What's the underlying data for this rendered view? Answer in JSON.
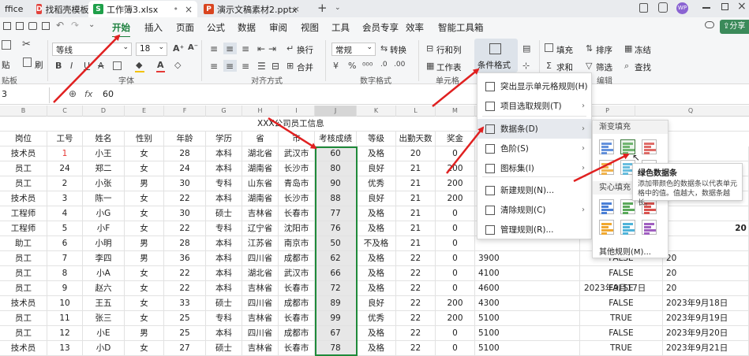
{
  "tabs": [
    {
      "label": "ffice"
    },
    {
      "label": "找稻壳模板",
      "icon": "D"
    },
    {
      "label": "工作簿3.xlsx",
      "icon": "S"
    },
    {
      "label": "演示文稿素材2.pptx",
      "icon": "P"
    }
  ],
  "new_tab_label": "+",
  "avatar_label": "WP",
  "share_label": "分享",
  "menus": [
    "开始",
    "插入",
    "页面",
    "公式",
    "数据",
    "审阅",
    "视图",
    "工具",
    "会员专享",
    "效率",
    "智能工具箱"
  ],
  "active_menu": "开始",
  "ribbon": {
    "font_name": "等线",
    "font_size": "18",
    "number_format": "常规",
    "wrap": "换行",
    "merge": "合并",
    "convert": "转换",
    "rowcol": "行和列",
    "worksheet": "工作表",
    "cond_format": "条件格式",
    "fill": "填充",
    "sort": "排序",
    "freeze": "冻结",
    "sum": "求和",
    "filter": "筛选",
    "find": "查找",
    "paste": "贴",
    "brush": "刷",
    "groups": [
      "贴板",
      "字体",
      "对齐方式",
      "数字格式",
      "单元格",
      "编辑"
    ]
  },
  "formula_bar": {
    "cell_ref": "3",
    "fx": "fx",
    "value": "60"
  },
  "columns": [
    "B",
    "C",
    "D",
    "E",
    "F",
    "G",
    "H",
    "I",
    "J",
    "K",
    "L",
    "M",
    "P",
    "Q"
  ],
  "sheet_title": "XXX公司员工信息",
  "headers": [
    "岗位",
    "工号",
    "姓名",
    "性别",
    "年龄",
    "学历",
    "省",
    "市",
    "考核成绩",
    "等级",
    "出勤天数",
    "奖金"
  ],
  "rows": [
    [
      "技术员",
      "1",
      "小王",
      "女",
      "28",
      "本科",
      "湖北省",
      "武汉市",
      "60",
      "及格",
      "20",
      "0",
      "",
      "",
      ""
    ],
    [
      "员工",
      "24",
      "郑二",
      "女",
      "24",
      "本科",
      "湖南省",
      "长沙市",
      "80",
      "良好",
      "21",
      "200",
      "",
      "",
      ""
    ],
    [
      "员工",
      "2",
      "小张",
      "男",
      "30",
      "专科",
      "山东省",
      "青岛市",
      "90",
      "优秀",
      "21",
      "200",
      "",
      "",
      ""
    ],
    [
      "技术员",
      "3",
      "陈一",
      "女",
      "22",
      "本科",
      "湖南省",
      "长沙市",
      "88",
      "良好",
      "21",
      "200",
      "",
      "",
      ""
    ],
    [
      "工程师",
      "4",
      "小G",
      "女",
      "30",
      "硕士",
      "吉林省",
      "长春市",
      "77",
      "及格",
      "21",
      "0",
      "",
      "",
      ""
    ],
    [
      "工程师",
      "5",
      "小F",
      "女",
      "22",
      "专科",
      "辽宁省",
      "沈阳市",
      "76",
      "及格",
      "21",
      "0",
      "",
      "",
      ""
    ],
    [
      "助工",
      "6",
      "小明",
      "男",
      "28",
      "本科",
      "江苏省",
      "南京市",
      "50",
      "不及格",
      "21",
      "0",
      "",
      "",
      ""
    ],
    [
      "员工",
      "7",
      "李四",
      "男",
      "36",
      "本科",
      "四川省",
      "成都市",
      "62",
      "及格",
      "22",
      "0",
      "3900",
      "FALSE",
      "20"
    ],
    [
      "员工",
      "8",
      "小A",
      "女",
      "22",
      "本科",
      "湖北省",
      "武汉市",
      "66",
      "及格",
      "22",
      "0",
      "4100",
      "FALSE",
      "20"
    ],
    [
      "员工",
      "9",
      "赵六",
      "女",
      "22",
      "本科",
      "吉林省",
      "长春市",
      "72",
      "及格",
      "22",
      "0",
      "4600",
      "FALSE",
      "20"
    ],
    [
      "技术员",
      "10",
      "王五",
      "女",
      "33",
      "硕士",
      "四川省",
      "成都市",
      "89",
      "良好",
      "22",
      "200",
      "4300",
      "FALSE",
      "2023年9月18日"
    ],
    [
      "员工",
      "11",
      "张三",
      "女",
      "25",
      "专科",
      "吉林省",
      "长春市",
      "99",
      "优秀",
      "22",
      "200",
      "5100",
      "TRUE",
      "2023年9月19日"
    ],
    [
      "员工",
      "12",
      "小E",
      "男",
      "25",
      "本科",
      "四川省",
      "成都市",
      "67",
      "及格",
      "22",
      "0",
      "5100",
      "FALSE",
      "2023年9月20日"
    ],
    [
      "技术员",
      "13",
      "小D",
      "女",
      "27",
      "硕士",
      "吉林省",
      "长春市",
      "78",
      "及格",
      "22",
      "0",
      "5100",
      "TRUE",
      "2023年9月21日"
    ]
  ],
  "partial_dates": [
    "2023年9月17日"
  ],
  "edge_value": "20",
  "cond_menu": [
    {
      "label": "突出显示单元格规则(H)",
      "arrow": true
    },
    {
      "label": "项目选取规则(T)",
      "arrow": true
    },
    {
      "label": "数据条(D)",
      "arrow": true
    },
    {
      "label": "色阶(S)",
      "arrow": true
    },
    {
      "label": "图标集(I)",
      "arrow": true
    },
    {
      "label": "新建规则(N)...",
      "arrow": false
    },
    {
      "label": "清除规则(C)",
      "arrow": true
    },
    {
      "label": "管理规则(R)...",
      "arrow": false
    }
  ],
  "submenu": {
    "gradient_title": "渐变填充",
    "solid_title": "实心填充",
    "more": "其他规则(M)..."
  },
  "bar_colors": [
    "#4a7fd6",
    "#5aa95a",
    "#d9534f",
    "#f0a830",
    "#4fb3d9",
    "#a05fc0"
  ],
  "tooltip": {
    "title": "绿色数据条",
    "body": "添加带颜色的数据条以代表单元格中的值。值越大，数据条越长。"
  }
}
